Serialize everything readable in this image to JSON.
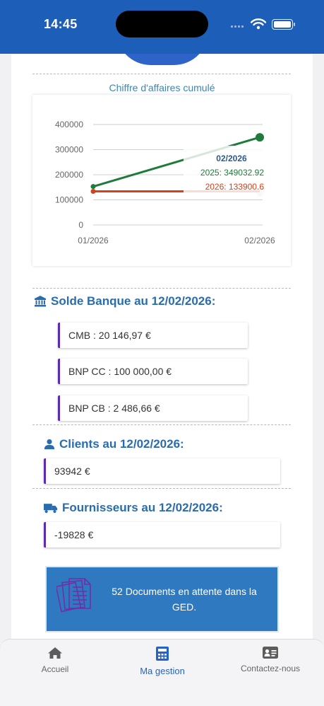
{
  "status_bar": {
    "time": "14:45"
  },
  "chart_title": "Chiffre d'affaires cumulé",
  "chart_data": {
    "type": "line",
    "title": "Chiffre d'affaires cumulé",
    "x": [
      "01/2026",
      "02/2026"
    ],
    "yticks": [
      "400000",
      "300000",
      "200000",
      "100000",
      "0"
    ],
    "ylim": [
      0,
      400000
    ],
    "grid": true,
    "series": [
      {
        "name": "2025",
        "color": "#1f7a3b",
        "values": [
          153000,
          349032.92
        ]
      },
      {
        "name": "2026",
        "color": "#d4421c",
        "values": [
          133900.6,
          133900.6
        ]
      }
    ],
    "tooltip": {
      "title": "02/2026",
      "lines": [
        "2025: 349032.92",
        "2026: 133900.6"
      ]
    }
  },
  "bank": {
    "title": "Solde Banque au 12/02/2026:",
    "icon": "bank-icon",
    "accounts": [
      "CMB : 20 146,97 €",
      "BNP CC : 100 000,00 €",
      "BNP CB : 2 486,66 €"
    ]
  },
  "clients": {
    "title": "Clients au 12/02/2026:",
    "icon": "user-icon",
    "value": "93942 €"
  },
  "suppliers": {
    "title": "Fournisseurs au 12/02/2026:",
    "icon": "truck-icon",
    "value": "-19828 €"
  },
  "ged": {
    "text": "52 Documents en attente dans la GED.",
    "icon": "documents-icon"
  },
  "tabs": [
    {
      "label": "Accueil",
      "icon": "home-icon"
    },
    {
      "label": "Ma gestion",
      "icon": "calculator-icon"
    },
    {
      "label": "Contactez-nous",
      "icon": "contact-card-icon"
    }
  ],
  "colors": {
    "header": "#1d5fb8",
    "accent": "#2a6cae",
    "card_border": "#5b2bb4",
    "ged_bg": "#2f79c0"
  }
}
